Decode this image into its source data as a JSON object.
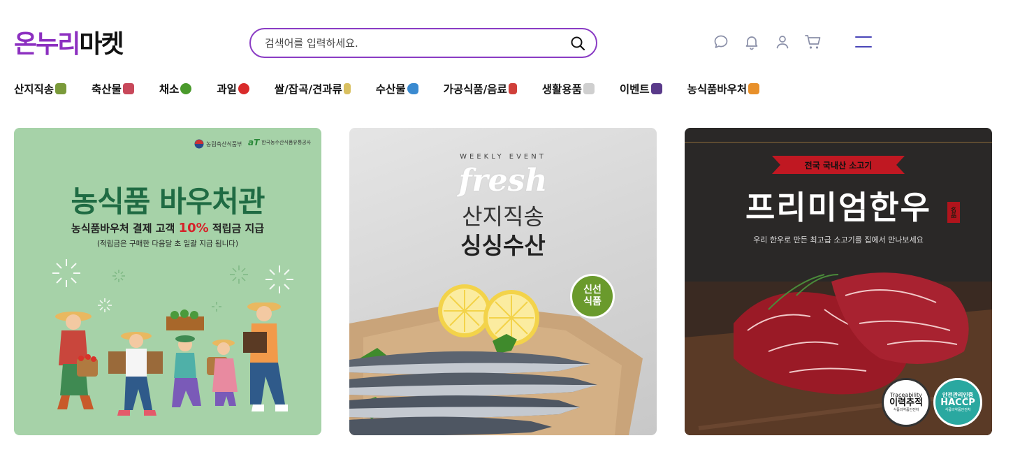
{
  "header": {
    "logo_part1": "온누리",
    "logo_part2": "마켓",
    "search_placeholder": "검색어를 입력하세요.",
    "icons": [
      "chat-icon",
      "bell-icon",
      "user-icon",
      "cart-icon",
      "menu-icon"
    ]
  },
  "nav": {
    "categories": [
      {
        "label": "산지직송",
        "emoji_color": "#7a9a3a"
      },
      {
        "label": "축산물",
        "emoji_color": "#c8485a"
      },
      {
        "label": "채소",
        "emoji_color": "#4a9a2c"
      },
      {
        "label": "과일",
        "emoji_color": "#d92b2b"
      },
      {
        "label": "쌀/잡곡/견과류",
        "emoji_color": "#d9c060"
      },
      {
        "label": "수산물",
        "emoji_color": "#3a8ad0"
      },
      {
        "label": "가공식품/음료",
        "emoji_color": "#d0403a"
      },
      {
        "label": "생활용품",
        "emoji_color": "#b0b0b0"
      },
      {
        "label": "이벤트",
        "emoji_color": "#5a3a8a"
      },
      {
        "label": "농식품바우처",
        "emoji_color": "#e8902a"
      }
    ]
  },
  "banners": {
    "voucher": {
      "org1": "농림축산식품부",
      "org2": "한국농수산식품유통공사",
      "title": "농식품 바우처관",
      "sub_pre": "농식품바우처 결제 고객 ",
      "sub_pct": "10%",
      "sub_post": " 적립금 지급",
      "note": "(적립금은 구매한 다음달 초 일괄 지급 됩니다)"
    },
    "seafood": {
      "eyebrow": "WEEKLY EVENT",
      "script": "fresh",
      "line1": "산지직송",
      "line2": "싱싱수산",
      "badge_line1": "신선",
      "badge_line2": "식품"
    },
    "beef": {
      "ribbon": "전국 국내산 소고기",
      "title": "프리미엄한우",
      "seal": "名品",
      "sub": "우리 한우로 만든 최고급 소고기를 집에서 만나보세요",
      "trace_en": "Traceability",
      "trace_ko": "이력추적",
      "trace_small": "식품의약품안전처",
      "haccp_top": "안전관리인증",
      "haccp": "HACCP",
      "haccp_small": "식품의약품안전처"
    }
  }
}
